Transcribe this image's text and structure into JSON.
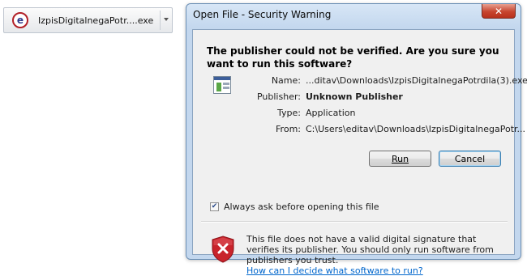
{
  "download_bar": {
    "icon": "ie-download-icon",
    "filename": "IzpisDigitalnegaPotr....exe"
  },
  "dialog": {
    "title": "Open File - Security Warning",
    "close_glyph": "✕",
    "question": "The publisher could not be verified.  Are you sure you want to run this software?",
    "details": [
      {
        "label": "Name:",
        "value": "...ditav\\Downloads\\IzpisDigitalnegaPotrdila(3).exe",
        "bold": false
      },
      {
        "label": "Publisher:",
        "value": "Unknown Publisher",
        "bold": true
      },
      {
        "label": "Type:",
        "value": "Application",
        "bold": false
      },
      {
        "label": "From:",
        "value": "C:\\Users\\editav\\Downloads\\IzpisDigitalnegaPotr...",
        "bold": false
      }
    ],
    "run_label": "Run",
    "cancel_label": "Cancel",
    "checkbox": {
      "label": "Always ask before opening this file",
      "checked": true
    },
    "warning_text": "This file does not have a valid digital signature that verifies its publisher.  You should only run software from publishers you trust.",
    "help_link": "How can I decide what software to run?"
  },
  "colors": {
    "accent": "#0066cc",
    "shield": "#c8232b",
    "close": "#c7452f"
  }
}
